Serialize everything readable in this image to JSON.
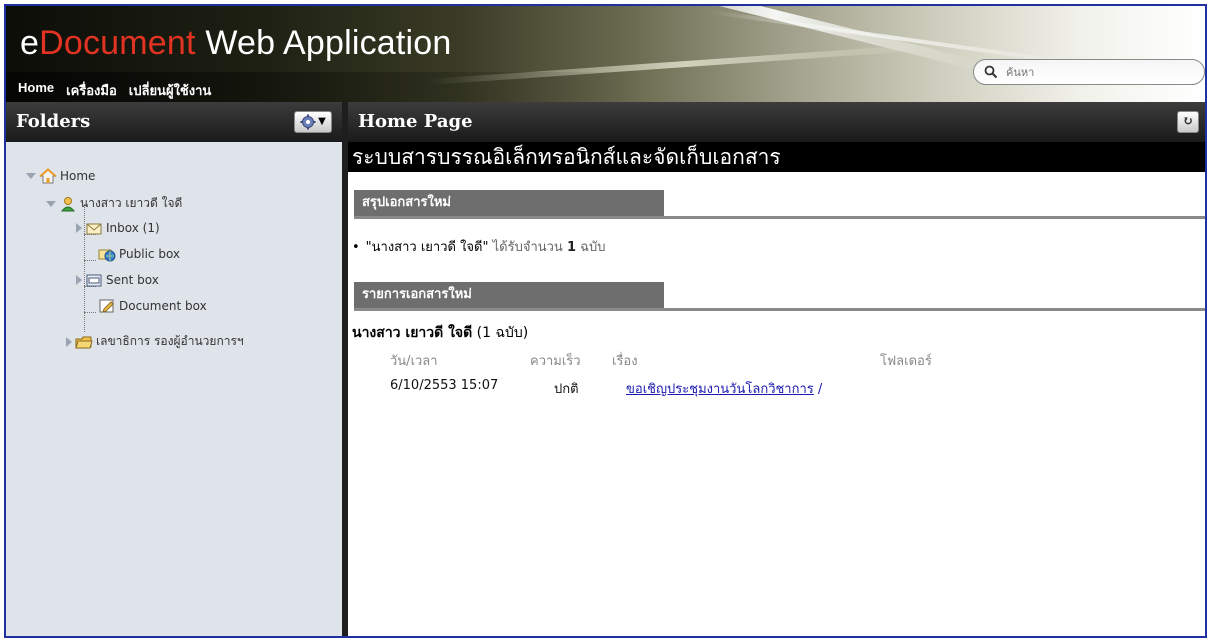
{
  "header": {
    "title_part1": "e",
    "title_part2": "Document",
    "title_part3": " Web Application",
    "nav": [
      "Home",
      "เครื่องมือ",
      "เปลี่ยนผู้ใช้งาน"
    ],
    "search_placeholder": "ค้นหา"
  },
  "left_panel": {
    "title": "Folders",
    "tree": {
      "root": "Home",
      "user": "นางสาว เยาวดี ใจดี",
      "folders": [
        "Inbox (1)",
        "Public box",
        "Sent box",
        "Document box"
      ],
      "other": "เลขาธิการ รองผู้อำนวยการฯ"
    }
  },
  "right_panel": {
    "title": "Home Page",
    "system_title": "ระบบสารบรรณอิเล็กทรอนิกส์และจัดเก็บเอกสาร",
    "summary_tab": "สรุปเอกสารใหม่",
    "summary": {
      "name": "\"นางสาว เยาวดี ใจดี\"",
      "text": " ได้รับจำนวน ",
      "count": "1",
      "unit": " ฉบับ"
    },
    "list_tab": "รายการเอกสารใหม่",
    "group_name": "นางสาว เยาวดี ใจดี",
    "group_count": " (1 ฉบับ)",
    "columns": [
      "วัน/เวลา",
      "ความเร็ว",
      "เรื่อง",
      "โฟลเดอร์"
    ],
    "row": {
      "datetime": "6/10/2553 15:07",
      "speed": "ปกติ",
      "subject": "ขอเชิญประชุมงานวันโลกวิชาการ",
      "folder": "/"
    }
  },
  "colors": {
    "accent_red": "#e23322",
    "panel_header": "#1e1e1e",
    "left_bg": "#dfe3ea",
    "tab_gray": "#6e6e6e",
    "link_blue": "#1a1ab0"
  }
}
